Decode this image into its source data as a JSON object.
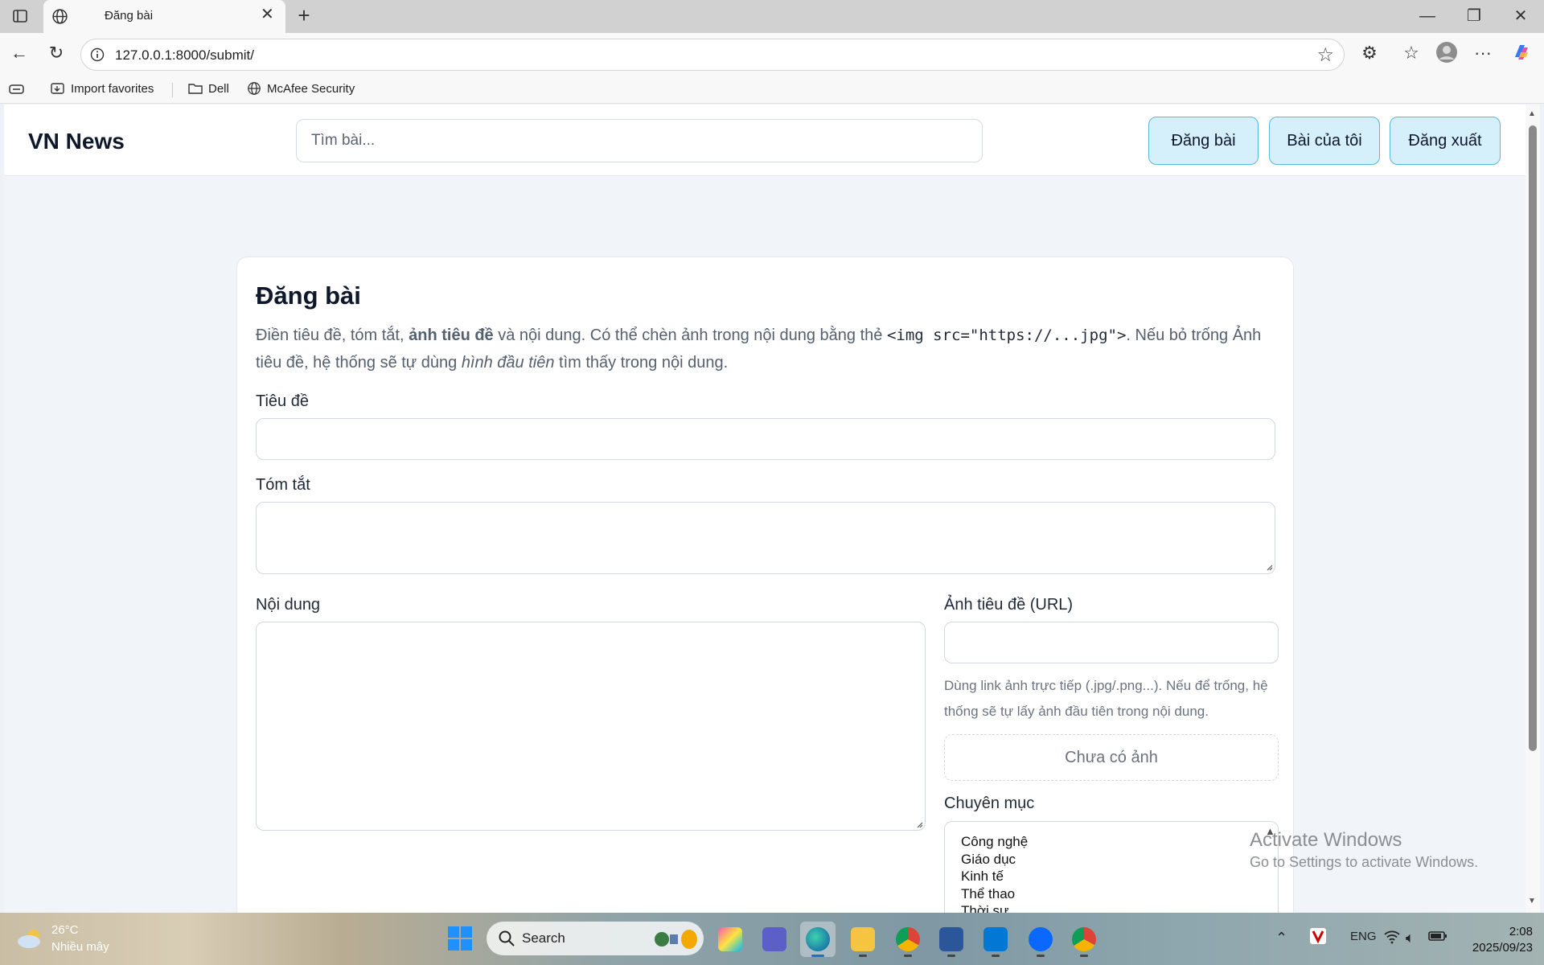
{
  "browser": {
    "tab_title": "Đăng bài",
    "url": "127.0.0.1:8000/submit/",
    "favorites": [
      "Import favorites",
      "Dell",
      "McAfee Security"
    ]
  },
  "site": {
    "brand": "VN News",
    "search_placeholder": "Tìm bài...",
    "nav": {
      "post": "Đăng bài",
      "my_posts": "Bài của tôi",
      "logout": "Đăng xuất"
    }
  },
  "form": {
    "heading": "Đăng bài",
    "intro": {
      "p1": "Điền tiêu đề, tóm tắt, ",
      "bold": "ảnh tiêu đề",
      "p2": " và nội dung. Có thể chèn ảnh trong nội dung bằng thẻ ",
      "code": "<img src=\"https://...jpg\">",
      "p3": ". Nếu bỏ trống Ảnh tiêu đề, hệ thống sẽ tự dùng ",
      "italic": "hình đầu tiên",
      "p4": " tìm thấy trong nội dung."
    },
    "title_label": "Tiêu đề",
    "title_value": "",
    "summary_label": "Tóm tắt",
    "summary_value": "",
    "content_label": "Nội dung",
    "content_value": "",
    "image_label": "Ảnh tiêu đề (URL)",
    "image_value": "",
    "image_hint": "Dùng link ảnh trực tiếp (.jpg/.png...). Nếu để trống, hệ thống sẽ tự lấy ảnh đầu tiên trong nội dung.",
    "image_preview": "Chưa có ảnh",
    "category_label": "Chuyên mục",
    "categories": [
      "Công nghệ",
      "Giáo dục",
      "Kinh tế",
      "Thể thao",
      "Thời sự"
    ]
  },
  "watermark": {
    "line1": "Activate Windows",
    "line2": "Go to Settings to activate Windows."
  },
  "taskbar": {
    "temperature": "26°C",
    "weather": "Nhiều mây",
    "search": "Search",
    "language": "ENG",
    "time": "2:08",
    "date": "2025/09/23"
  },
  "colors": {
    "accent_pill": "#d6f0fb",
    "accent_border": "#5bb7d9",
    "page_bg": "#f1f4f8"
  }
}
